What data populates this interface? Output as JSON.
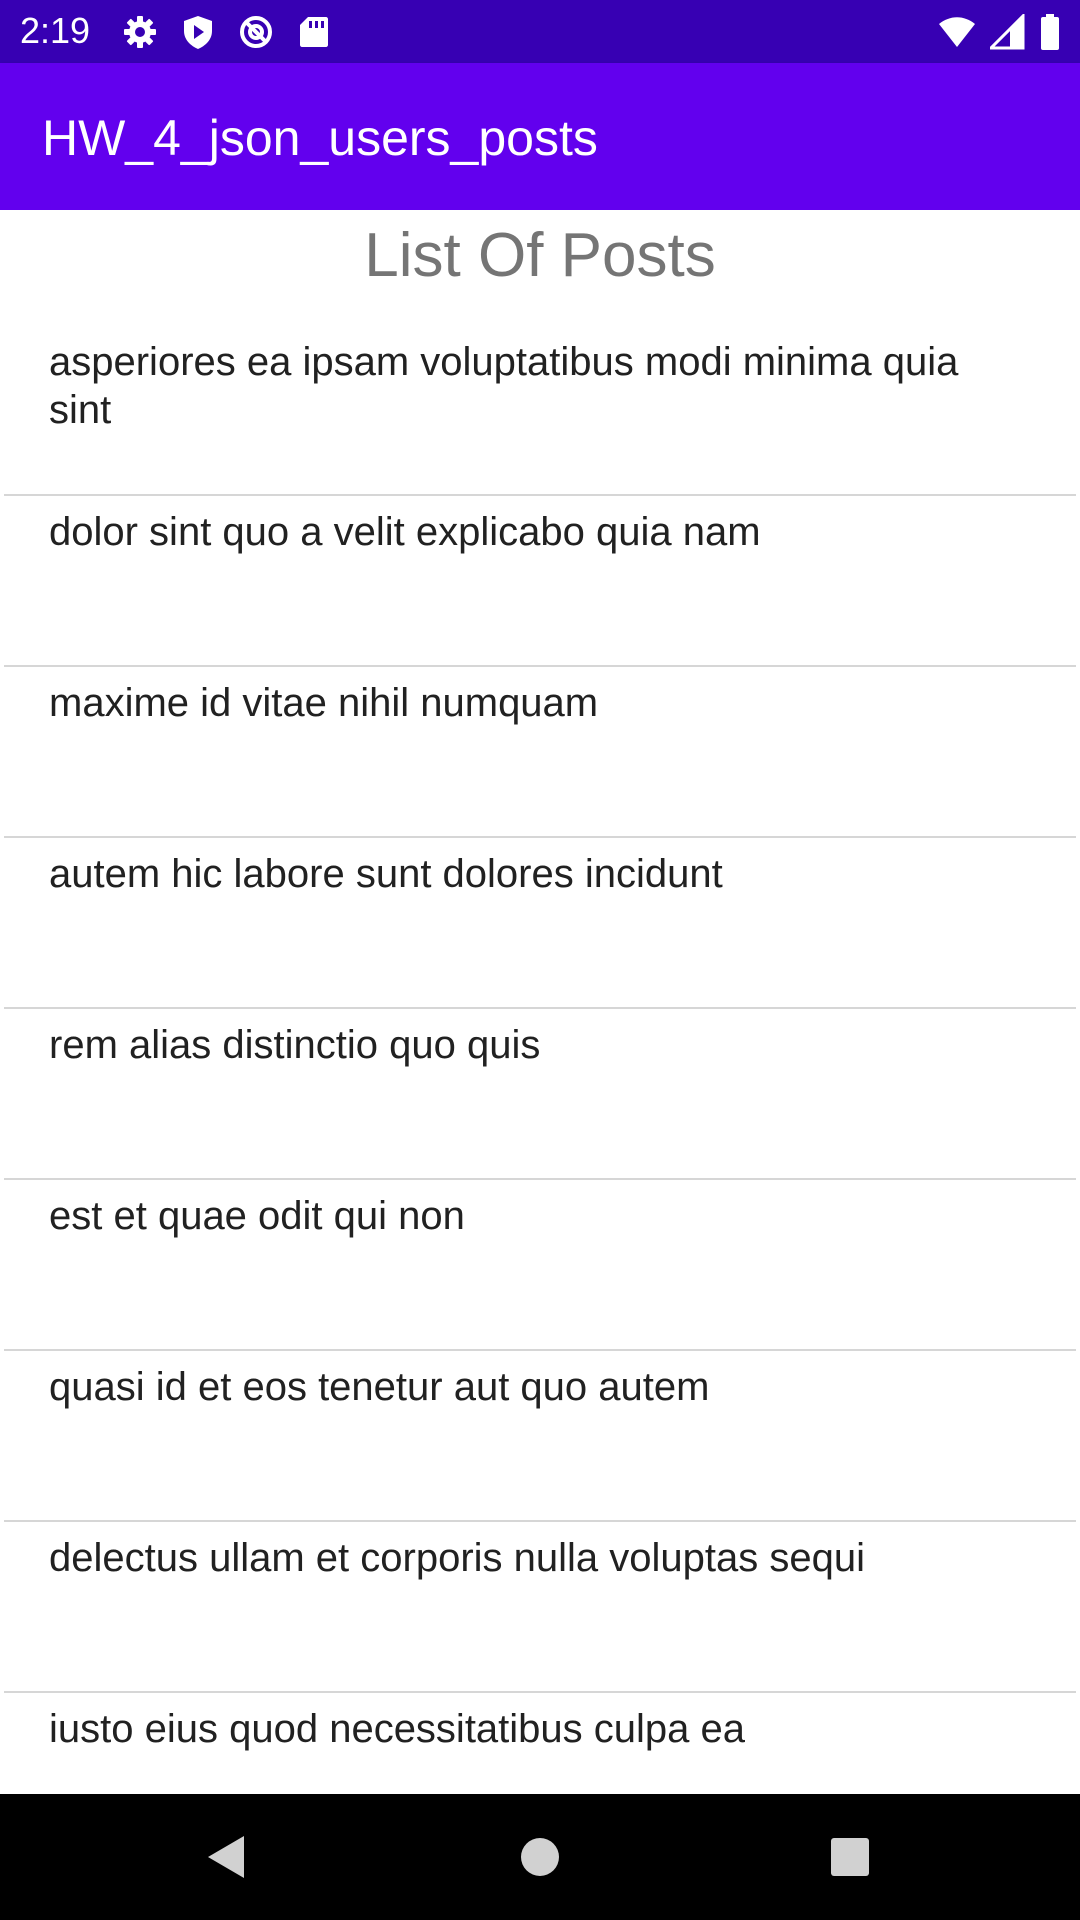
{
  "status_bar": {
    "time": "2:19",
    "left_icons": [
      "settings-icon",
      "shield-icon",
      "vpn-icon",
      "sd-card-icon"
    ],
    "right_icons": [
      "wifi-icon",
      "signal-icon",
      "battery-icon"
    ]
  },
  "app_bar": {
    "title": "HW_4_json_users_posts",
    "color": "#6200ee"
  },
  "page": {
    "heading": "List Of Posts"
  },
  "posts": [
    "asperiores ea ipsam voluptatibus modi minima quia sint",
    "dolor sint quo a velit explicabo quia nam",
    "maxime id vitae nihil numquam",
    "autem hic labore sunt dolores incidunt",
    "rem alias distinctio quo quis",
    "est et quae odit qui non",
    "quasi id et eos tenetur aut quo autem",
    "delectus ullam et corporis nulla voluptas sequi",
    "iusto eius quod necessitatibus culpa ea"
  ],
  "nav_bar": {
    "buttons": [
      "back-icon",
      "home-icon",
      "recents-icon"
    ]
  },
  "colors": {
    "status_bar": "#3700b3",
    "app_bar": "#6200ee",
    "heading_text": "#757575",
    "item_text": "#212121",
    "divider": "#d6d6d6"
  }
}
